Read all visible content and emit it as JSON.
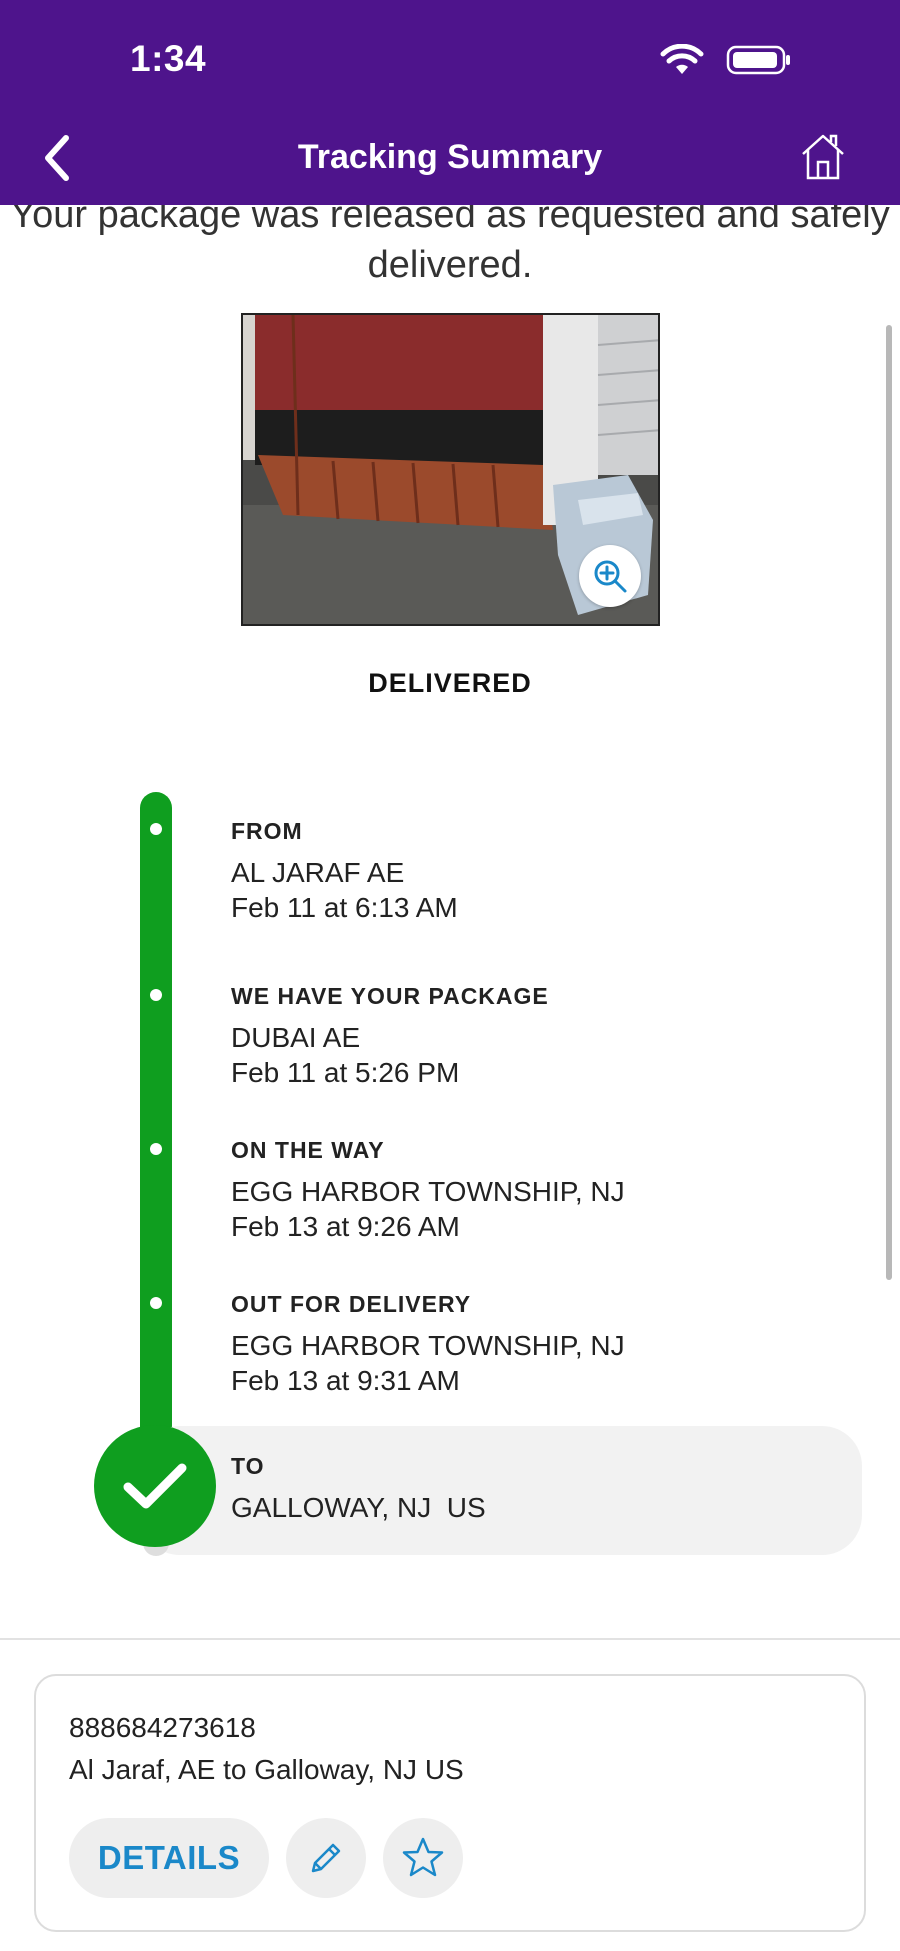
{
  "status_bar": {
    "time": "1:34"
  },
  "nav": {
    "title": "Tracking Summary",
    "back_icon": "chevron-left-icon",
    "home_icon": "home-icon"
  },
  "message": "Your package was released as requested and safely delivered.",
  "status": "DELIVERED",
  "timeline": [
    {
      "title": "FROM",
      "location": "AL JARAF AE",
      "time": "Feb 11 at 6:13 AM"
    },
    {
      "title": "WE HAVE YOUR PACKAGE",
      "location": "DUBAI AE",
      "time": "Feb 11 at 5:26 PM"
    },
    {
      "title": "ON THE WAY",
      "location": "EGG HARBOR TOWNSHIP, NJ",
      "time": "Feb 13 at 9:26 AM"
    },
    {
      "title": "OUT FOR DELIVERY",
      "location": "EGG HARBOR TOWNSHIP, NJ",
      "time": "Feb 13 at 9:31 AM"
    },
    {
      "title": "TO",
      "location": "GALLOWAY, NJ  US"
    }
  ],
  "shipment": {
    "tracking_number": "888684273618",
    "route": "Al Jaraf, AE to Galloway, NJ US",
    "details_label": "DETAILS"
  },
  "colors": {
    "header": "#4e148c",
    "timeline": "#0f9e1f",
    "accent": "#1a88c9"
  }
}
